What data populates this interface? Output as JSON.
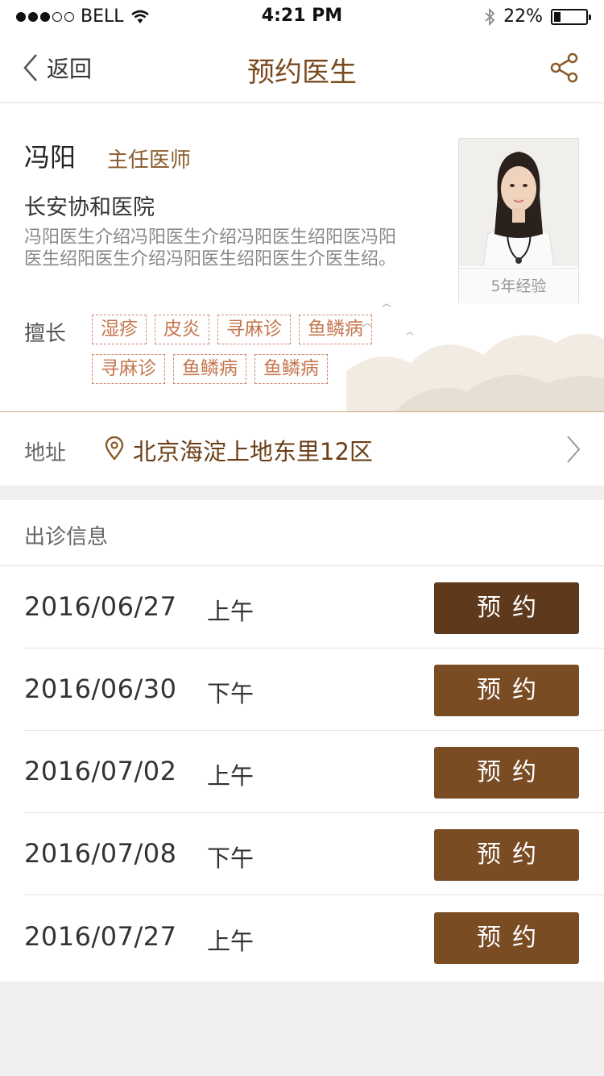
{
  "status_bar": {
    "carrier": "BELL",
    "time": "4:21 PM",
    "battery": "22%",
    "battery_level": 0.22
  },
  "nav": {
    "back_label": "返回",
    "title": "预约医生"
  },
  "doctor": {
    "name": "冯阳",
    "title": "主任医师",
    "hospital": "长安协和医院",
    "intro": "冯阳医生介绍冯阳医生介绍冯阳医生绍阳医冯阳医生绍阳医生介绍冯阳医生绍阳医生介医生绍。",
    "experience": "5年经验",
    "skill_label": "擅长",
    "skills": [
      "湿疹",
      "皮炎",
      "寻麻诊",
      "鱼鳞病",
      "寻麻诊",
      "鱼鳞病",
      "鱼鳞病"
    ]
  },
  "address": {
    "label": "地址",
    "value": "北京海淀上地东里12区"
  },
  "schedule": {
    "title": "出诊信息",
    "button_label": "预约",
    "rows": [
      {
        "date": "2016/06/27",
        "period": "上午",
        "button": "预约"
      },
      {
        "date": "2016/06/30",
        "period": "下午",
        "button": "预约"
      },
      {
        "date": "2016/07/02",
        "period": "上午",
        "button": "预约"
      },
      {
        "date": "2016/07/08",
        "period": "下午",
        "button": "预约"
      },
      {
        "date": "2016/07/27",
        "period": "上午",
        "button": "预约"
      }
    ]
  },
  "colors": {
    "brand": "#7a4c24",
    "brand_pressed": "#5e391b",
    "tag": "#c4774f",
    "title": "#7a4a1e"
  },
  "icons": [
    "signal-dots-icon",
    "wifi-icon",
    "bluetooth-icon",
    "battery-icon",
    "back-arrow-icon",
    "share-icon",
    "location-pin-icon",
    "chevron-right-icon"
  ]
}
